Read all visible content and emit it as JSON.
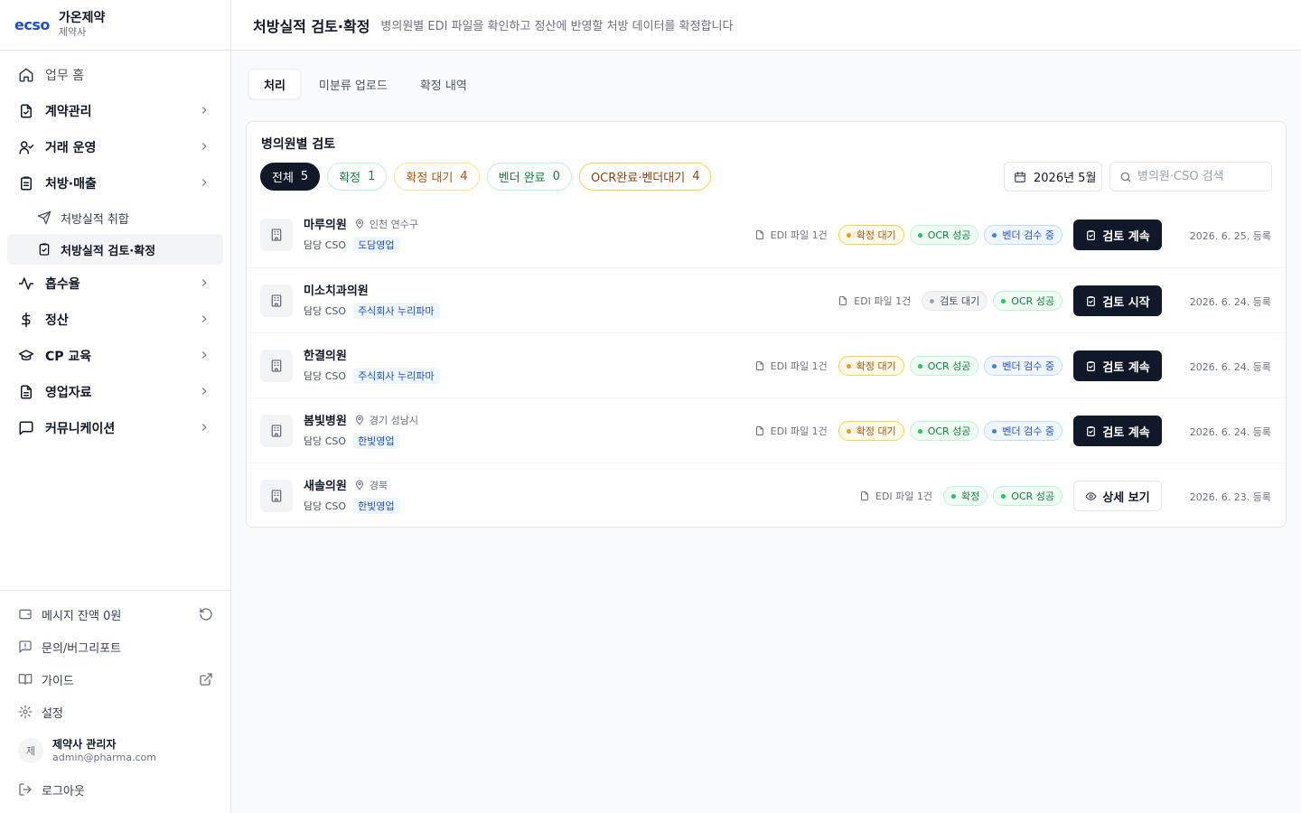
{
  "brand": {
    "logo": "ecso",
    "company": "가온제약",
    "role": "제약사"
  },
  "nav": {
    "home": "업무 홈",
    "contracts": "계약관리",
    "trade": "거래 운영",
    "prescription": "처방·매출",
    "sub_collect": "처방실적 취합",
    "sub_review": "처방실적 검토·확정",
    "absorption": "흡수율",
    "settlement": "정산",
    "cp": "CP 교육",
    "sales_material": "영업자료",
    "communication": "커뮤니케이션"
  },
  "bottom": {
    "balance": "메시지 잔액 0원",
    "inquiry": "문의/버그리포트",
    "guide": "가이드",
    "settings": "설정",
    "avatar": "제",
    "user_name": "제약사 관리자",
    "user_email": "admin@pharma.com",
    "logout": "로그아웃"
  },
  "header": {
    "title": "처방실적 검토·확정",
    "desc": "병의원별 EDI 파일을 확인하고 정산에 반영할 처방 데이터를 확정합니다"
  },
  "tabs": [
    "처리",
    "미분류 업로드",
    "확정 내역"
  ],
  "card": {
    "title": "병의원별 검토",
    "filters": [
      {
        "label": "전체",
        "count": "5"
      },
      {
        "label": "확정",
        "count": "1"
      },
      {
        "label": "확정 대기",
        "count": "4"
      },
      {
        "label": "벤더 완료",
        "count": "0"
      },
      {
        "label": "OCR완료·벤더대기",
        "count": "4"
      }
    ],
    "month": "2026년 5월",
    "search_placeholder": "병의원·CSO 검색"
  },
  "rows": [
    {
      "name": "마루의원",
      "loc": "인천 연수구",
      "cso_label": "담당 CSO",
      "cso": "도담영업",
      "edi": "EDI 파일 1건",
      "b1": "확정 대기",
      "b2": "OCR 성공",
      "b3": "벤더 검수 중",
      "action": "검토 계속",
      "date": "2026. 6. 25. 등록"
    },
    {
      "name": "미소치과의원",
      "loc": "",
      "cso_label": "담당 CSO",
      "cso": "주식회사 누리파마",
      "edi": "EDI 파일 1건",
      "b1": "검토 대기",
      "b2": "OCR 성공",
      "action": "검토 시작",
      "date": "2026. 6. 24. 등록"
    },
    {
      "name": "한결의원",
      "loc": "",
      "cso_label": "담당 CSO",
      "cso": "주식회사 누리파마",
      "edi": "EDI 파일 1건",
      "b1": "확정 대기",
      "b2": "OCR 성공",
      "b3": "벤더 검수 중",
      "action": "검토 계속",
      "date": "2026. 6. 24. 등록"
    },
    {
      "name": "봄빛병원",
      "loc": "경기 성남시",
      "cso_label": "담당 CSO",
      "cso": "한빛영업",
      "edi": "EDI 파일 1건",
      "b1": "확정 대기",
      "b2": "OCR 성공",
      "b3": "벤더 검수 중",
      "action": "검토 계속",
      "date": "2026. 6. 24. 등록"
    },
    {
      "name": "새솔의원",
      "loc": "경북",
      "cso_label": "담당 CSO",
      "cso": "한빛영업",
      "edi": "EDI 파일 1건",
      "b1": "확정",
      "b2": "OCR 성공",
      "action": "상세 보기",
      "date": "2026. 6. 23. 등록"
    }
  ],
  "colors": {
    "accent": "#1d4ed8",
    "dark": "#111827",
    "amber": "#b45309",
    "green": "#15803d"
  }
}
